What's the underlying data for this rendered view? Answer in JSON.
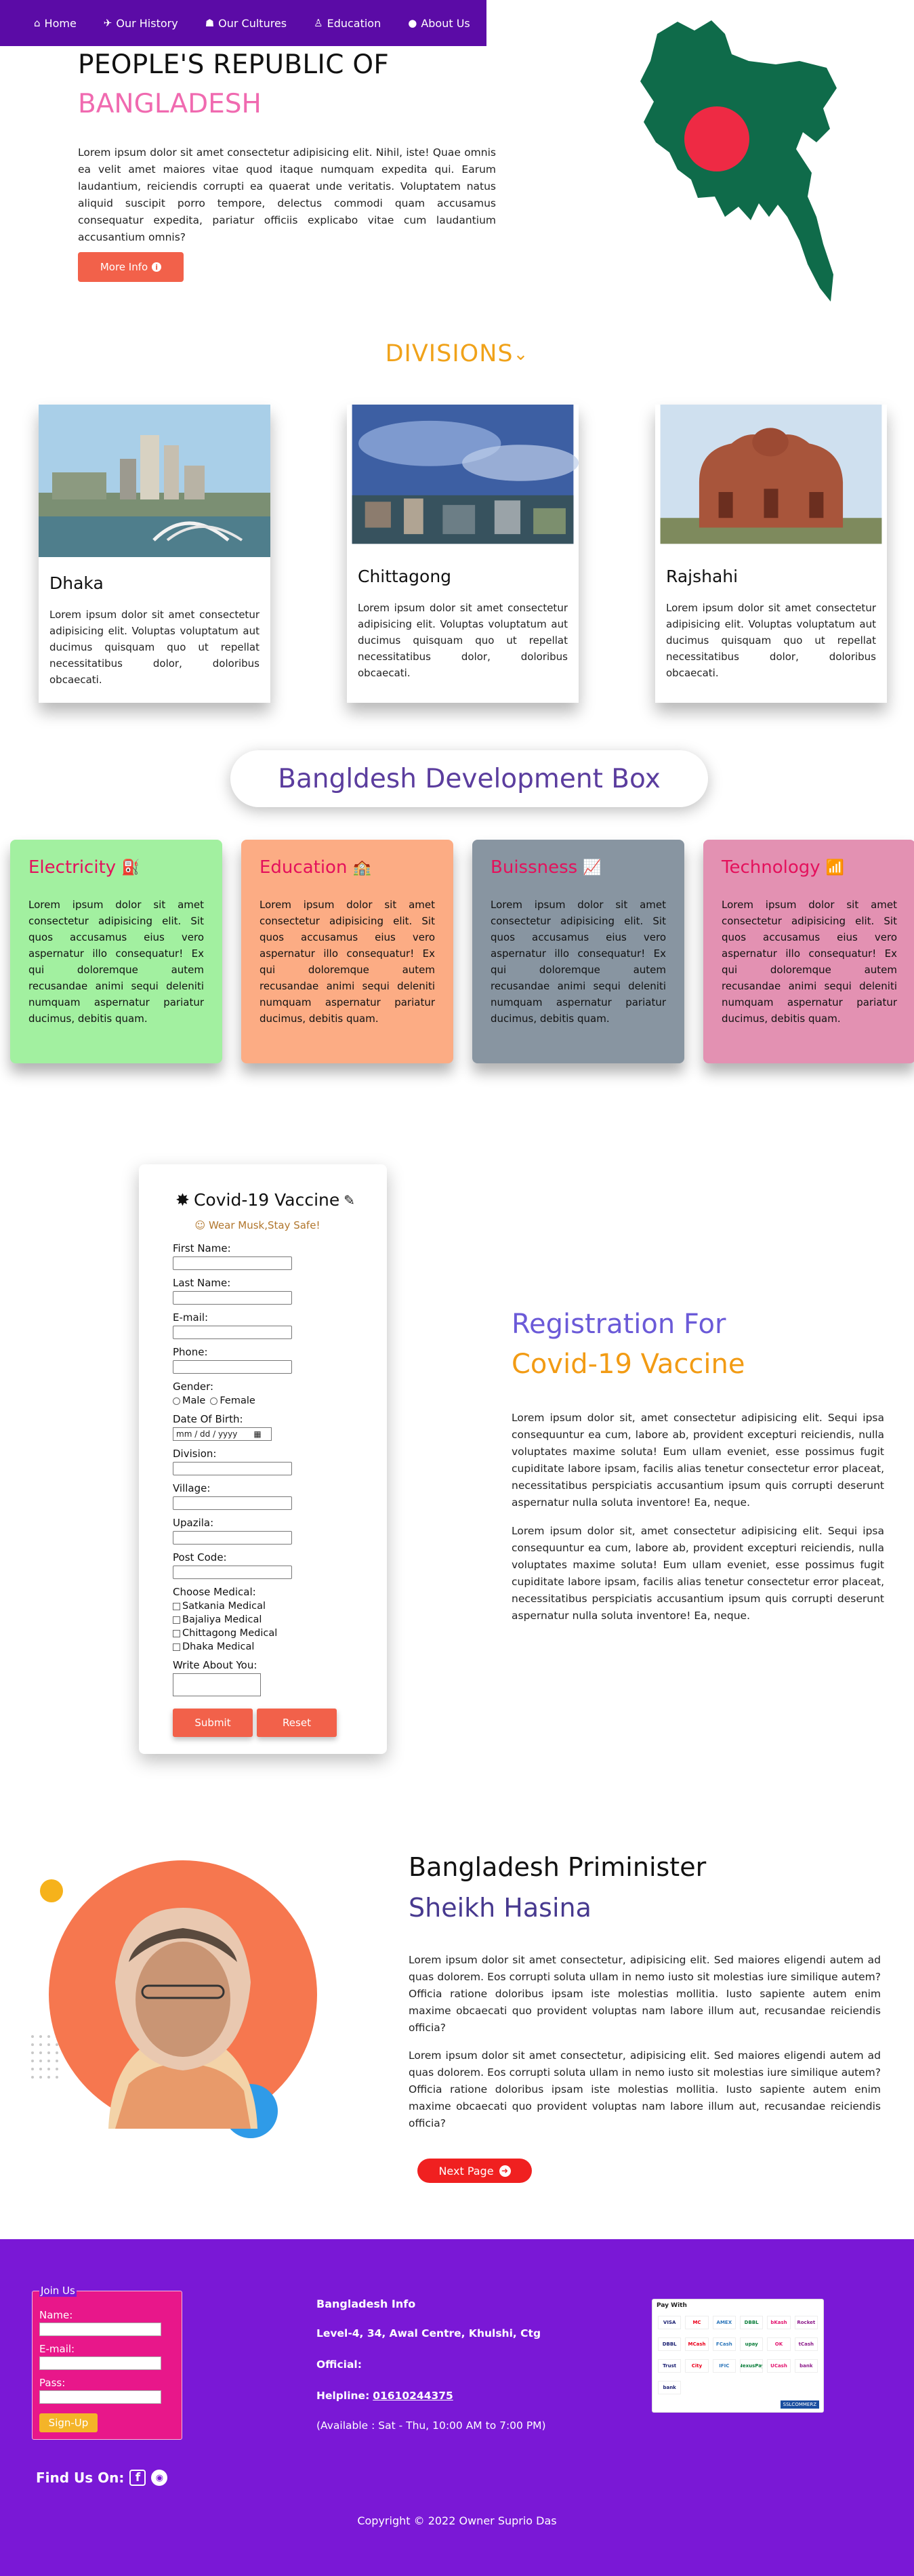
{
  "nav": [
    {
      "label": "Home",
      "icon": "home-icon"
    },
    {
      "label": "Our History",
      "icon": "plane-icon"
    },
    {
      "label": "Our Cultures",
      "icon": "users-icon"
    },
    {
      "label": "Education",
      "icon": "graduate-icon"
    },
    {
      "label": "About Us",
      "icon": "user-icon"
    }
  ],
  "hero": {
    "title1": "PEOPLE'S REPUBLIC OF",
    "title2": "BANGLADESH",
    "text": "Lorem ipsum dolor sit amet consectetur adipisicing elit. Nihil, iste! Quae omnis ea velit amet maiores vitae quod itaque numquam expedita qui. Earum laudantium, reiciendis corrupti ea quaerat unde veritatis. Voluptatem natus aliquid suscipit porro tempore, delectus commodi quam accusamus consequatur expedita, pariatur officiis explicabo vitae cum laudantium accusantium omnis?",
    "button": "More Info",
    "colors": {
      "map": "#0f6b4a",
      "circle": "#ee2a44"
    }
  },
  "divisions": {
    "title": "DIVISIONS",
    "cards": [
      {
        "name": "Dhaka",
        "text": "Lorem ipsum dolor sit amet consectetur adipisicing elit. Voluptas voluptatum aut ducimus quisquam quo ut repellat necessitatibus dolor, doloribus obcaecati."
      },
      {
        "name": "Chittagong",
        "text": "Lorem ipsum dolor sit amet consectetur adipisicing elit. Voluptas voluptatum aut ducimus quisquam quo ut repellat necessitatibus dolor, doloribus obcaecati."
      },
      {
        "name": "Rajshahi",
        "text": "Lorem ipsum dolor sit amet consectetur adipisicing elit. Voluptas voluptatum aut ducimus quisquam quo ut repellat necessitatibus dolor, doloribus obcaecati."
      }
    ]
  },
  "development": {
    "title": "Bangldesh Development Box",
    "boxes": [
      {
        "title": "Electricity",
        "icon": "charging-station-icon",
        "bg": "#a2f0a0",
        "color": "#e4115c",
        "text": "Lorem ipsum dolor sit amet consectetur adipisicing elit. Sit quos accusamus eius vero aspernatur illo consequatur! Ex qui doloremque autem recusandae animi sequi deleniti numquam aspernatur pariatur ducimus, debitis quam."
      },
      {
        "title": "Education",
        "icon": "school-icon",
        "bg": "#fcac84",
        "color": "#e4115c",
        "text": "Lorem ipsum dolor sit amet consectetur adipisicing elit. Sit quos accusamus eius vero aspernatur illo consequatur! Ex qui doloremque autem recusandae animi sequi deleniti numquam aspernatur pariatur ducimus, debitis quam."
      },
      {
        "title": "Buissness",
        "icon": "chart-line-icon",
        "bg": "#8895a1",
        "color": "#e4115c",
        "text": "Lorem ipsum dolor sit amet consectetur adipisicing elit. Sit quos accusamus eius vero aspernatur illo consequatur! Ex qui doloremque autem recusandae animi sequi deleniti numquam aspernatur pariatur ducimus, debitis quam."
      },
      {
        "title": "Technology",
        "icon": "wifi-icon",
        "bg": "#e391b2",
        "color": "#e4115c",
        "text": "Lorem ipsum dolor sit amet consectetur adipisicing elit. Sit quos accusamus eius vero aspernatur illo consequatur! Ex qui doloremque autem recusandae animi sequi deleniti numquam aspernatur pariatur ducimus, debitis quam."
      }
    ]
  },
  "form": {
    "title": "Covid-19 Vaccine",
    "note": "Wear Musk,Stay Safe!",
    "first_name": "First Name:",
    "last_name": "Last Name:",
    "email": "E-mail:",
    "phone": "Phone:",
    "gender": "Gender:",
    "male": "Male",
    "female": "Female",
    "dob": "Date Of Birth:",
    "dob_placeholder": "mm / dd / yyyy",
    "division": "Division:",
    "village": "Village:",
    "upazila": "Upazila:",
    "post_code": "Post Code:",
    "choose_medical": "Choose Medical:",
    "medicals": [
      "Satkania Medical",
      "Bajaliya Medical",
      "Chittagong Medical",
      "Dhaka Medical"
    ],
    "write_about": "Write About You:",
    "submit": "Submit",
    "reset": "Reset"
  },
  "registration": {
    "title1": "Registration For",
    "title2": "Covid-19 Vaccine",
    "para1": "Lorem ipsum dolor sit, amet consectetur adipisicing elit. Sequi ipsa consequuntur ea cum, labore ab, provident excepturi reiciendis, nulla voluptates maxime soluta! Eum ullam eveniet, esse possimus fugit cupiditate labore ipsam, facilis alias tenetur consectetur error placeat, necessitatibus perspiciatis accusantium ipsum quis corrupti deserunt aspernatur nulla soluta inventore! Ea, neque.",
    "para2": "Lorem ipsum dolor sit, amet consectetur adipisicing elit. Sequi ipsa consequuntur ea cum, labore ab, provident excepturi reiciendis, nulla voluptates maxime soluta! Eum ullam eveniet, esse possimus fugit cupiditate labore ipsam, facilis alias tenetur consectetur error placeat, necessitatibus perspiciatis accusantium ipsum quis corrupti deserunt aspernatur nulla soluta inventore! Ea, neque."
  },
  "pm": {
    "title1": "Bangladesh Priminister",
    "title2": "Sheikh Hasina",
    "para1": "Lorem ipsum dolor sit amet consectetur, adipisicing elit. Sed maiores eligendi autem ad quas dolorem. Eos corrupti soluta ullam in nemo iusto sit molestias iure similique autem? Officia ratione doloribus ipsam iste molestias mollitia. Iusto sapiente autem enim maxime obcaecati quo provident voluptas nam labore illum aut, recusandae reiciendis officia?",
    "para2": "Lorem ipsum dolor sit amet consectetur, adipisicing elit. Sed maiores eligendi autem ad quas dolorem. Eos corrupti soluta ullam in nemo iusto sit molestias iure similique autem? Officia ratione doloribus ipsam iste molestias mollitia. Iusto sapiente autem enim maxime obcaecati quo provident voluptas nam labore illum aut, recusandae reiciendis officia?",
    "button": "Next Page"
  },
  "footer": {
    "join_legend": "Join Us",
    "name_label": "Name:",
    "email_label": "E-mail:",
    "pass_label": "Pass:",
    "signup": "Sign-Up",
    "info_title": "Bangladesh Info",
    "address": "Level-4, 34, Awal Centre, Khulshi, Ctg",
    "official": "Official:",
    "helpline_label": "Helpline:",
    "helpline": "01610244375",
    "hours": "(Available : Sat - Thu, 10:00 AM to 7:00 PM)",
    "pay_title": "Pay With",
    "pay_logos": [
      "VISA",
      "MC",
      "AMEX",
      "DBBL",
      "bKash",
      "Rocket",
      "DBBL",
      "MCash",
      "FCash",
      "upay",
      "OK",
      "tCash",
      "Trust",
      "City",
      "IFIC",
      "NexusPay",
      "UCash",
      "bank",
      "bank"
    ],
    "verified": "SSLCOMMERZ",
    "find_us": "Find Us On:",
    "copyright": "Copyright © 2022 Owner Suprio Das",
    "bg": "#7a18d6"
  }
}
